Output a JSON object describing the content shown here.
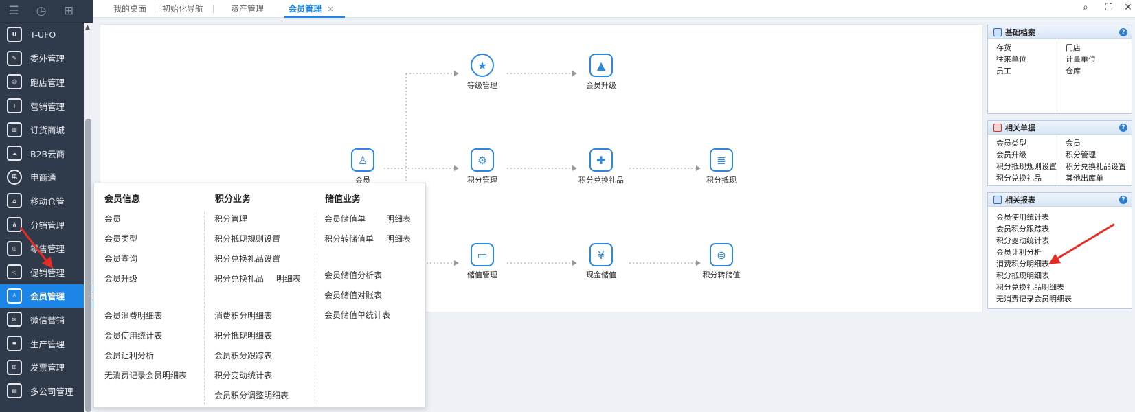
{
  "sidebar": {
    "items": [
      {
        "label": "T-UFO",
        "icon": "ufo-icon"
      },
      {
        "label": "委外管理",
        "icon": "outsource-icon"
      },
      {
        "label": "跑店管理",
        "icon": "store-visit-icon"
      },
      {
        "label": "营销管理",
        "icon": "marketing-icon"
      },
      {
        "label": "订货商城",
        "icon": "mall-icon"
      },
      {
        "label": "B2B云商",
        "icon": "b2b-icon"
      },
      {
        "label": "电商通",
        "icon": "ecommerce-icon"
      },
      {
        "label": "移动仓管",
        "icon": "mobile-warehouse-icon"
      },
      {
        "label": "分销管理",
        "icon": "distribution-icon"
      },
      {
        "label": "零售管理",
        "icon": "retail-icon"
      },
      {
        "label": "促销管理",
        "icon": "promotion-icon"
      },
      {
        "label": "会员管理",
        "icon": "member-icon",
        "active": true
      },
      {
        "label": "微信营销",
        "icon": "wechat-icon"
      },
      {
        "label": "生产管理",
        "icon": "production-icon"
      },
      {
        "label": "发票管理",
        "icon": "invoice-icon"
      },
      {
        "label": "多公司管理",
        "icon": "multi-company-icon"
      }
    ]
  },
  "tabs": [
    {
      "label": "我的桌面"
    },
    {
      "label": "初始化导航"
    },
    {
      "label": "资产管理"
    },
    {
      "label": "会员管理",
      "active": true,
      "close": "×"
    }
  ],
  "toolbar": {
    "search_icon": "search-icon",
    "fullscreen_icon": "fullscreen-icon",
    "close_icon": "close-icon"
  },
  "flow": {
    "nodes": {
      "member": "会员",
      "level": "等级管理",
      "upgrade": "会员升级",
      "points": "积分管理",
      "gift": "积分兑换礼品",
      "deduct": "积分抵现",
      "stored": "储值管理",
      "cash": "现金储值",
      "points_stored": "积分转储值"
    }
  },
  "popup": {
    "col1": {
      "title": "会员信息",
      "items": [
        "会员",
        "会员类型",
        "会员查询",
        "会员升级",
        "会员消费明细表",
        "会员使用统计表",
        "会员让利分析",
        "无消费记录会员明细表"
      ]
    },
    "col2": {
      "title": "积分业务",
      "items": [
        "积分管理",
        "积分抵现规则设置",
        "积分兑换礼品设置",
        "积分兑换礼品",
        "明细表",
        "消费积分明细表",
        "积分抵现明细表",
        "会员积分跟踪表",
        "积分变动统计表",
        "会员积分调整明细表"
      ]
    },
    "col3": {
      "title": "储值业务",
      "items": [
        "会员储值单",
        "明细表",
        "积分转储值单",
        "明细表",
        "会员储值分析表",
        "会员储值对账表",
        "会员储值单统计表"
      ]
    }
  },
  "panels": {
    "basic": {
      "title": "基础档案",
      "help": "?",
      "left": [
        "存货",
        "往来单位",
        "员工"
      ],
      "right": [
        "门店",
        "计量单位",
        "仓库"
      ]
    },
    "docs": {
      "title": "相关单据",
      "help": "?",
      "left": [
        "会员类型",
        "会员升级",
        "积分抵现规则设置",
        "积分兑换礼品"
      ],
      "right": [
        "会员",
        "积分管理",
        "积分兑换礼品设置",
        "其他出库单"
      ]
    },
    "reports": {
      "title": "相关报表",
      "help": "?",
      "items": [
        "会员使用统计表",
        "会员积分跟踪表",
        "积分变动统计表",
        "会员让利分析",
        "消费积分明细表",
        "积分抵现明细表",
        "积分兑换礼品明细表",
        "无消费记录会员明细表"
      ]
    }
  },
  "colors": {
    "sidebar_bg": "#2f3a4a",
    "accent": "#1c86e8",
    "arrow_red": "#e62b24"
  }
}
